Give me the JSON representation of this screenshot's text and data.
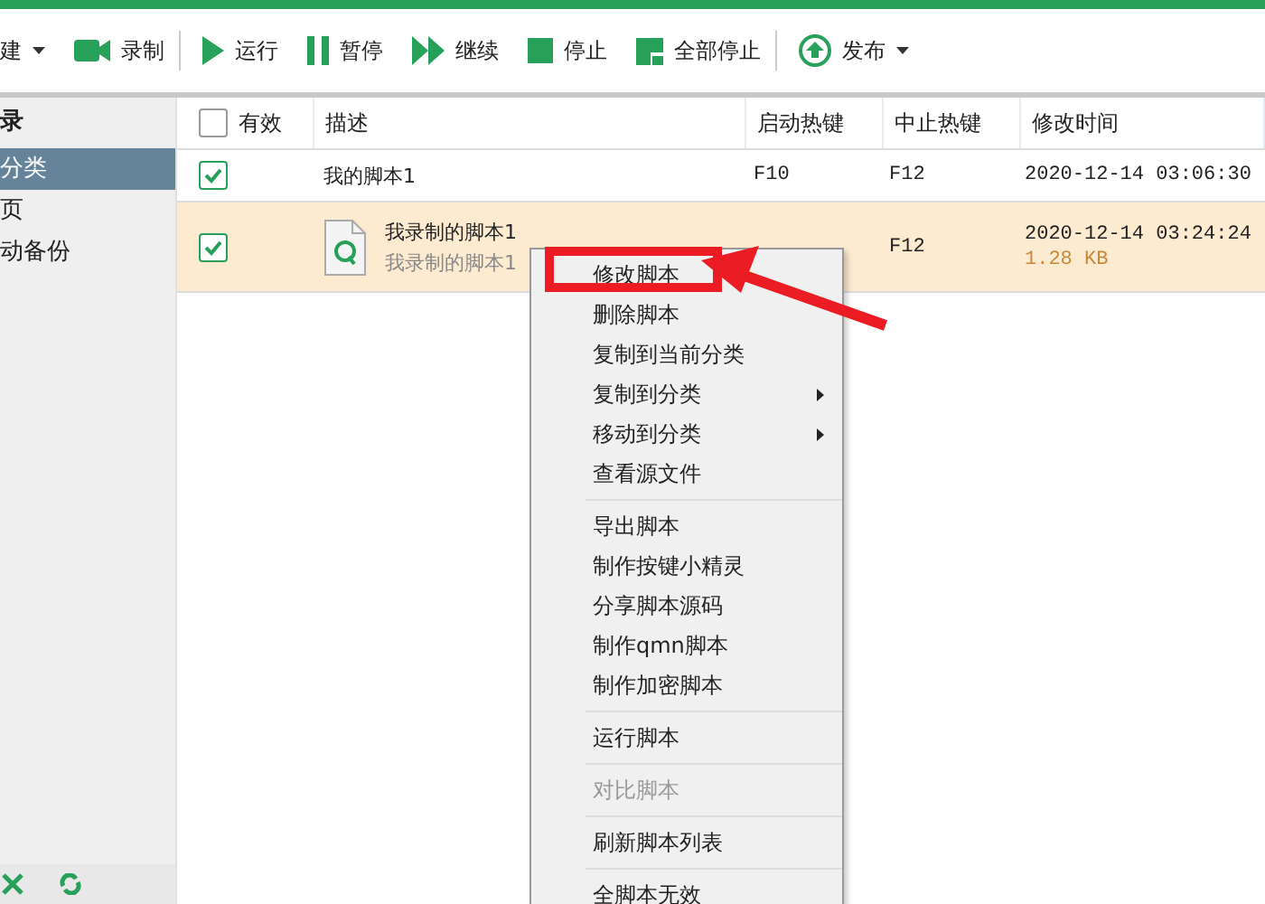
{
  "toolbar": [
    {
      "label": "建",
      "kind": "plain",
      "caret": true,
      "sep_after": false
    },
    {
      "label": "录制",
      "kind": "record",
      "caret": false,
      "sep_after": true
    },
    {
      "label": "运行",
      "kind": "run",
      "caret": false,
      "sep_after": false
    },
    {
      "label": "暂停",
      "kind": "pause",
      "caret": false,
      "sep_after": false
    },
    {
      "label": "继续",
      "kind": "resume",
      "caret": false,
      "sep_after": false
    },
    {
      "label": "停止",
      "kind": "stop",
      "caret": false,
      "sep_after": false
    },
    {
      "label": "全部停止",
      "kind": "stopall",
      "caret": false,
      "sep_after": true
    },
    {
      "label": "发布",
      "kind": "publish",
      "caret": true,
      "sep_after": false
    }
  ],
  "sidebar": {
    "title": "录",
    "items": [
      {
        "label": "分类",
        "selected": true
      },
      {
        "label": "页",
        "selected": false
      },
      {
        "label": "动备份",
        "selected": false
      }
    ]
  },
  "table": {
    "check_header": {
      "label": "有效",
      "checked": false
    },
    "columns": [
      "描述",
      "启动热键",
      "中止热键",
      "修改时间"
    ],
    "rows": [
      {
        "checked": true,
        "highlighted": false,
        "icon": false,
        "title": "我的脚本1",
        "start": "F10",
        "stop": "F12",
        "time": "2020-12-14 03:06:30"
      },
      {
        "checked": true,
        "highlighted": true,
        "icon": true,
        "title": "我录制的脚本1",
        "subtitle": "我录制的脚本1",
        "stop": "F12",
        "time": "2020-12-14 03:24:24",
        "size": "1.28 KB"
      }
    ]
  },
  "context_menu": {
    "groups": [
      [
        {
          "label": "修改脚本",
          "disabled": false,
          "submenu": false
        },
        {
          "label": "删除脚本",
          "disabled": false,
          "submenu": false
        },
        {
          "label": "复制到当前分类",
          "disabled": false,
          "submenu": false
        },
        {
          "label": "复制到分类",
          "disabled": false,
          "submenu": true
        },
        {
          "label": "移动到分类",
          "disabled": false,
          "submenu": true
        },
        {
          "label": "查看源文件",
          "disabled": false,
          "submenu": false
        }
      ],
      [
        {
          "label": "导出脚本",
          "disabled": false,
          "submenu": false
        },
        {
          "label": "制作按键小精灵",
          "disabled": false,
          "submenu": false
        },
        {
          "label": "分享脚本源码",
          "disabled": false,
          "submenu": false
        },
        {
          "label": "制作qmn脚本",
          "disabled": false,
          "submenu": false
        },
        {
          "label": "制作加密脚本",
          "disabled": false,
          "submenu": false
        }
      ],
      [
        {
          "label": "运行脚本",
          "disabled": false,
          "submenu": false
        }
      ],
      [
        {
          "label": "对比脚本",
          "disabled": true,
          "submenu": false
        }
      ],
      [
        {
          "label": "刷新脚本列表",
          "disabled": false,
          "submenu": false
        }
      ],
      [
        {
          "label": "全脚本无效",
          "disabled": false,
          "submenu": false
        }
      ]
    ]
  }
}
